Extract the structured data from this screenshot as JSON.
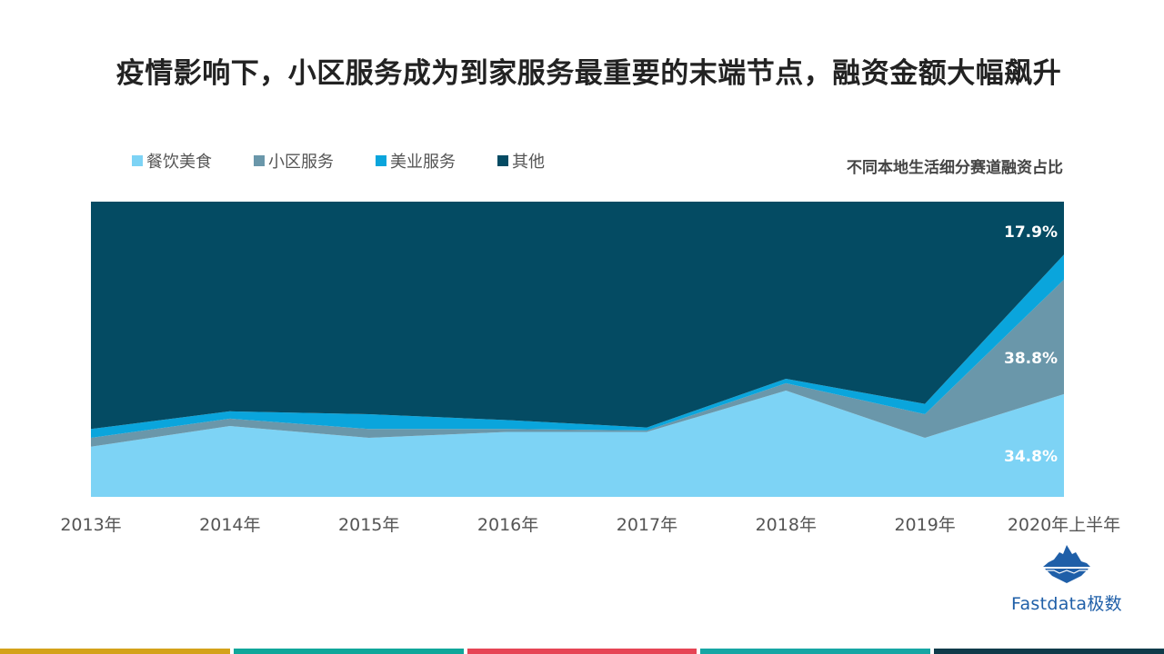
{
  "title": "疫情影响下，小区服务成为到家服务最重要的末端节点，融资金额大幅飙升",
  "subtitle": "不同本地生活细分赛道融资占比",
  "logo": {
    "text": "Fastdata极数",
    "icon": "iceberg-icon"
  },
  "colors": {
    "food": "#7dd3f5",
    "community": "#6a97aa",
    "beauty": "#0aa5dc",
    "other": "#044b63",
    "bottom_bar": [
      "#d4a21a",
      "#10a79a",
      "#e64455",
      "#16a6a4",
      "#0f3b4a"
    ]
  },
  "chart_data": {
    "type": "area",
    "stacked": true,
    "percent": true,
    "title": "不同本地生活细分赛道融资占比",
    "categories": [
      "2013年",
      "2014年",
      "2015年",
      "2016年",
      "2017年",
      "2018年",
      "2019年",
      "2020年上半年"
    ],
    "ylim": [
      0,
      100
    ],
    "legend_position": "top-left",
    "series": [
      {
        "name": "餐饮美食",
        "key": "food",
        "values": [
          17,
          24,
          20,
          22,
          22,
          36,
          20,
          34.8
        ]
      },
      {
        "name": "小区服务",
        "key": "community",
        "values": [
          3,
          2.5,
          3,
          1,
          0.5,
          2.5,
          8,
          38.8
        ]
      },
      {
        "name": "美业服务",
        "key": "beauty",
        "values": [
          3,
          2.5,
          5,
          3,
          1,
          1.5,
          3.5,
          8.5
        ]
      },
      {
        "name": "其他",
        "key": "other",
        "values": [
          77,
          71,
          72,
          74,
          76.5,
          60,
          68.5,
          17.9
        ]
      }
    ],
    "data_labels": [
      {
        "series": "餐饮美食",
        "category": "2020年上半年",
        "text": "34.8%"
      },
      {
        "series": "小区服务",
        "category": "2020年上半年",
        "text": "38.8%"
      },
      {
        "series": "其他",
        "category": "2020年上半年",
        "text": "17.9%"
      }
    ]
  }
}
